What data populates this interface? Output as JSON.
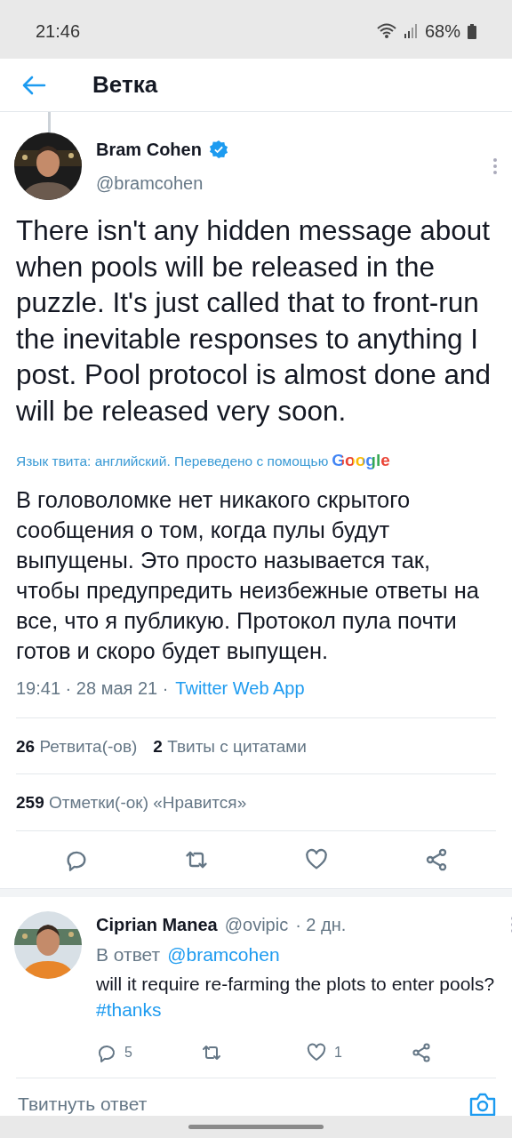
{
  "status_bar": {
    "time": "21:46",
    "battery": "68%"
  },
  "header": {
    "title": "Ветка"
  },
  "tweet": {
    "name": "Bram Cohen",
    "verified": true,
    "handle": "@bramcohen",
    "text": "There isn't any hidden message about when pools will be released in the puzzle. It's just called that to front-run the inevitable responses to anything I post. Pool protocol is almost done and will be released very soon.",
    "translation_note": "Язык твита: английский. Переведено с помощью",
    "translation_provider": "Google",
    "translated_text": "В головоломке нет никакого скрытого сообщения о том, когда пулы будут выпущены. Это просто называется так, чтобы предупредить неизбежные ответы на все, что я публикую. Протокол пула почти готов и скоро будет выпущен.",
    "timestamp": "19:41 · 28 мая 21 ·",
    "source": "Twitter Web App",
    "stats": [
      {
        "count": "26",
        "label": "Ретвита(-ов)"
      },
      {
        "count": "2",
        "label": "Твиты с цитатами"
      }
    ],
    "likes": {
      "count": "259",
      "label": "Отметки(-ок) «Нравится»"
    },
    "actions": [
      {
        "kind": "reply"
      },
      {
        "kind": "retweet"
      },
      {
        "kind": "like"
      },
      {
        "kind": "share"
      }
    ]
  },
  "reply": {
    "name": "Ciprian Manea",
    "handle": "@ovipic",
    "time": "· 2 дн.",
    "reply_to_label": "В ответ",
    "reply_to": "@bramcohen",
    "text": "will it require re-farming the plots to enter pools?",
    "hashtag": "#thanks",
    "actions": [
      {
        "kind": "reply",
        "count": "5"
      },
      {
        "kind": "retweet"
      },
      {
        "kind": "like",
        "count": "1"
      },
      {
        "kind": "share"
      }
    ]
  },
  "compose": {
    "placeholder": "Твитнуть ответ"
  }
}
